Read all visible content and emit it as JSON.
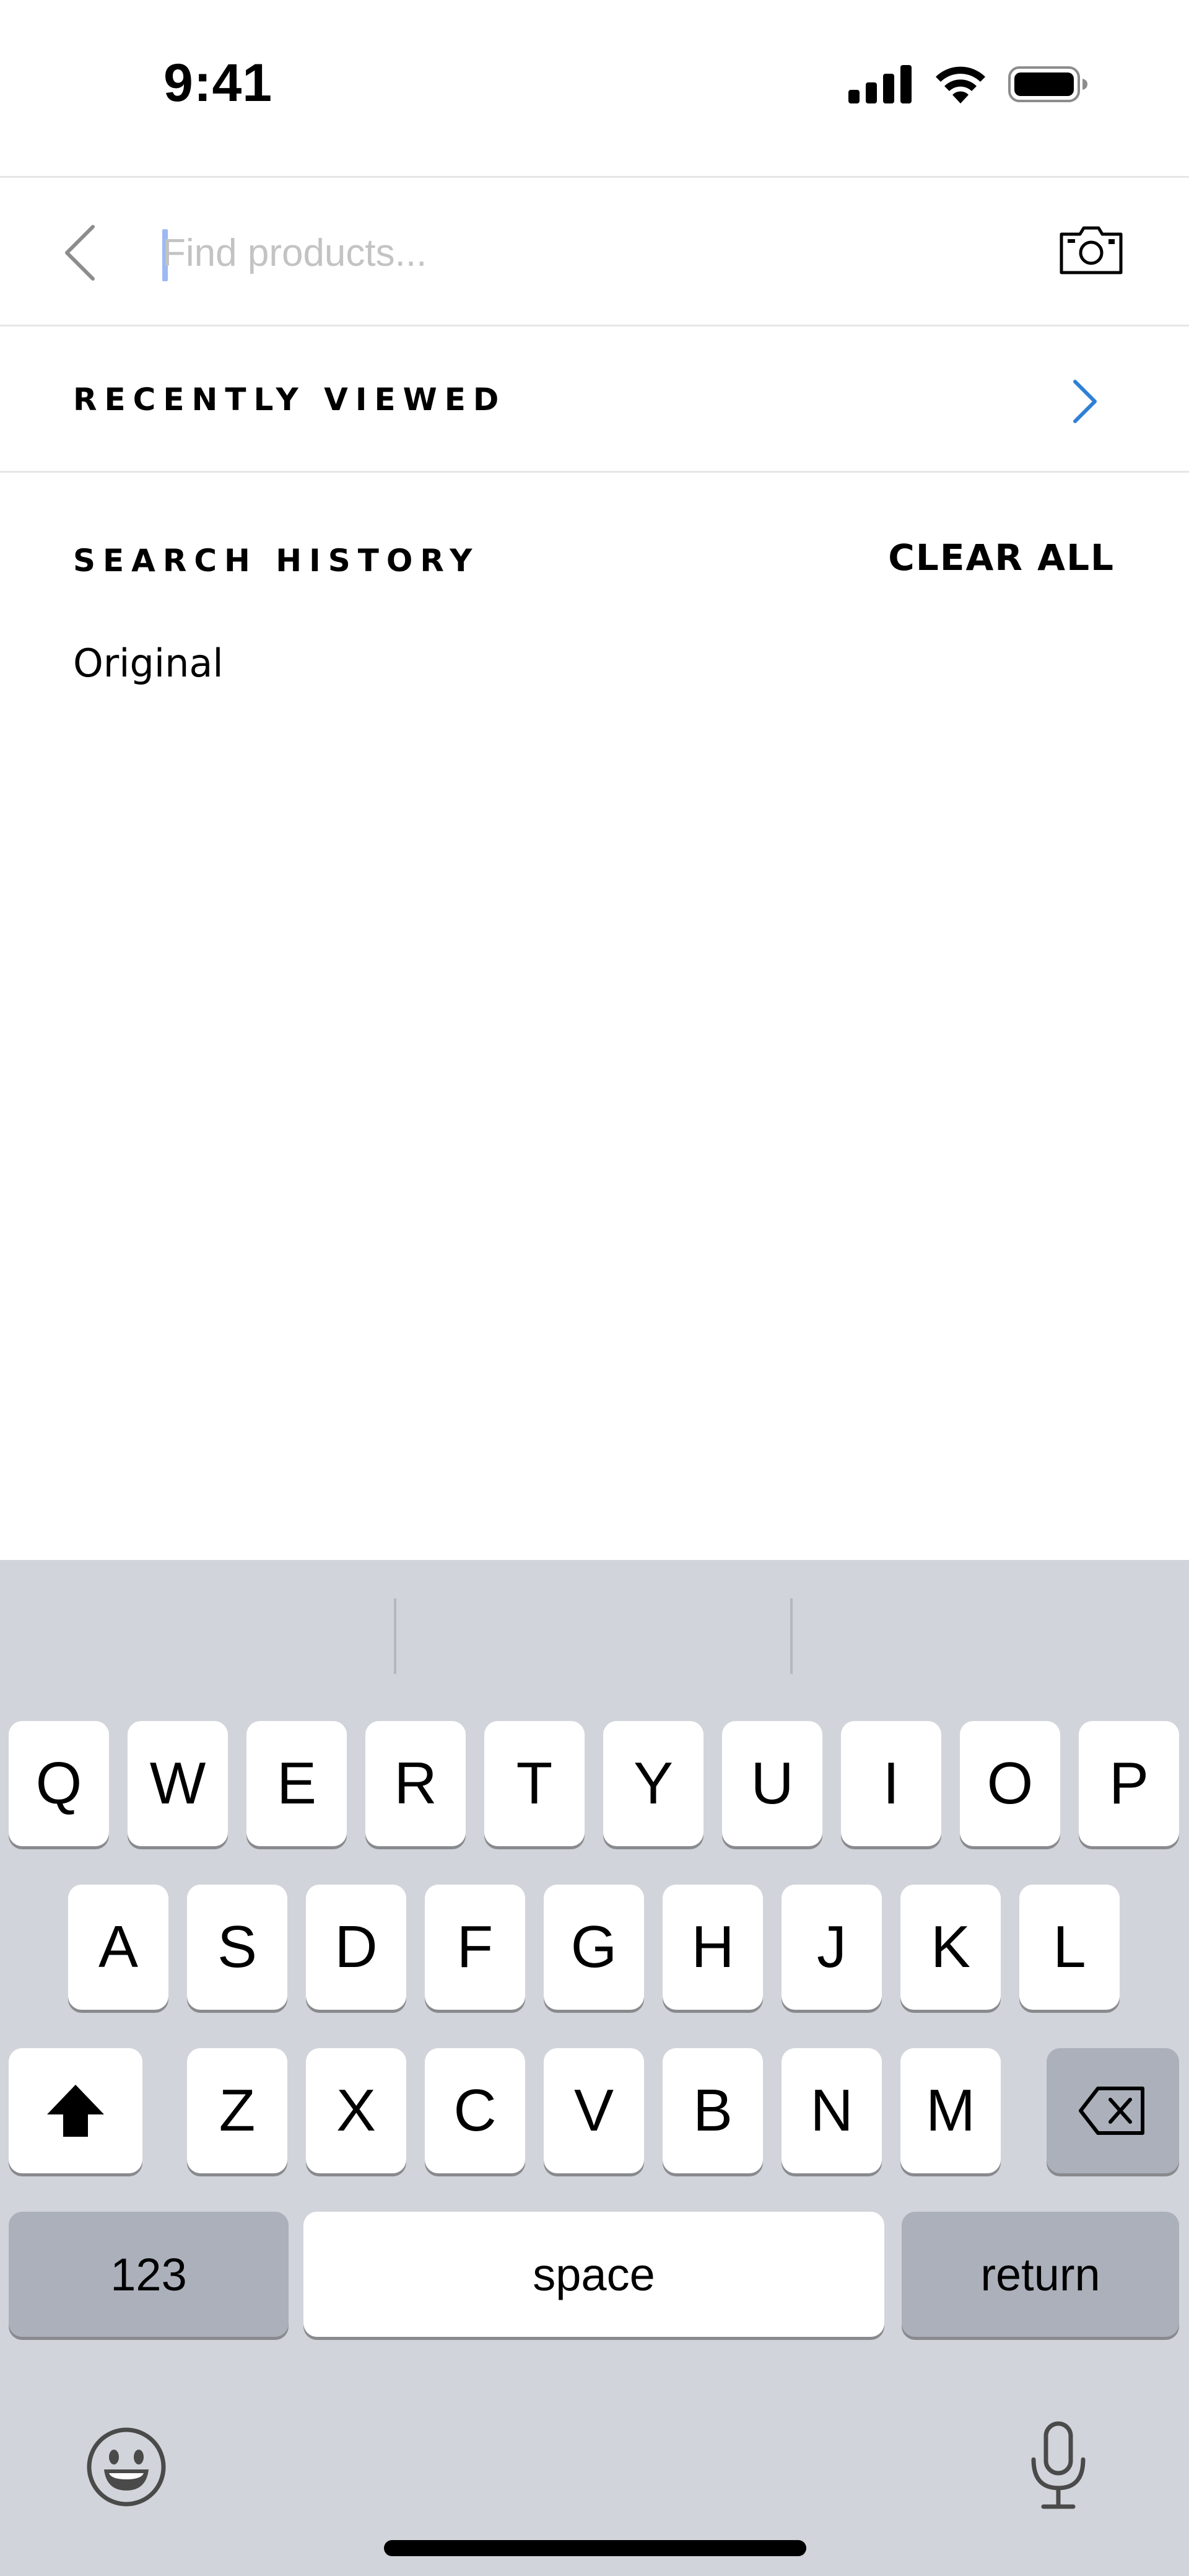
{
  "status_bar": {
    "time": "9:41",
    "icons": [
      "signal-icon",
      "wifi-icon",
      "battery-icon"
    ]
  },
  "search": {
    "placeholder": "Find products...",
    "value": "",
    "back_icon": "chevron-left-icon",
    "camera_icon": "camera-icon"
  },
  "recently_viewed": {
    "title": "RECENTLY VIEWED",
    "chevron_icon": "chevron-right-icon",
    "accent": "#2f7fd6"
  },
  "search_history": {
    "title": "SEARCH HISTORY",
    "clear_label": "CLEAR ALL",
    "items": [
      "Original"
    ]
  },
  "keyboard": {
    "row1": [
      "Q",
      "W",
      "E",
      "R",
      "T",
      "Y",
      "U",
      "I",
      "O",
      "P"
    ],
    "row2": [
      "A",
      "S",
      "D",
      "F",
      "G",
      "H",
      "J",
      "K",
      "L"
    ],
    "row3": [
      "Z",
      "X",
      "C",
      "V",
      "B",
      "N",
      "M"
    ],
    "numbers_label": "123",
    "space_label": "space",
    "return_label": "return",
    "shift_icon": "shift-icon",
    "delete_icon": "delete-icon",
    "emoji_icon": "emoji-icon",
    "mic_icon": "microphone-icon"
  }
}
